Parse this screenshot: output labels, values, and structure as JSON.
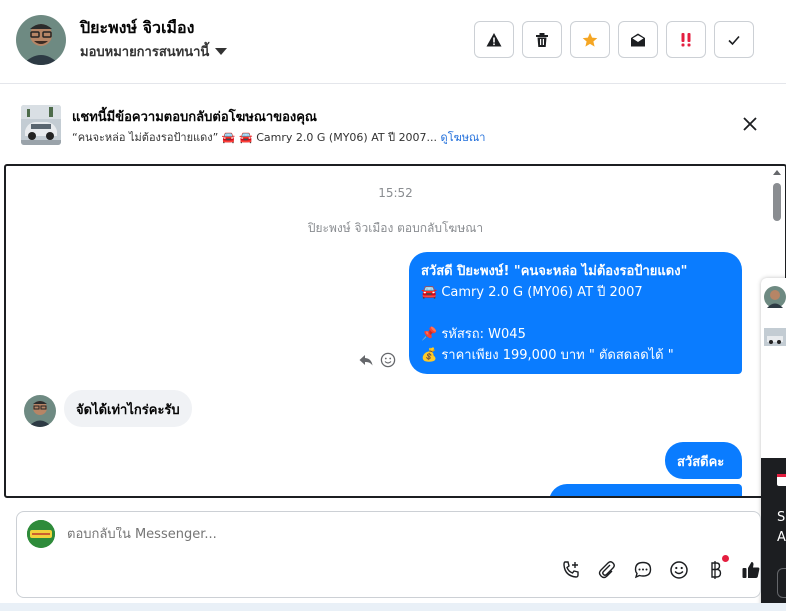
{
  "header": {
    "contact_name": "ปิยะพงษ์ จิวเมือง",
    "assign_label": "มอบหมายการสนทนานี้",
    "toolbar": [
      "spam",
      "delete",
      "star",
      "mark-unread",
      "important",
      "done"
    ]
  },
  "ad_banner": {
    "title": "แชทนี้มีข้อความตอบกลับต่อโฆษณาของคุณ",
    "subtitle": "“คนจะหล่อ ไม่ต้องรอป้ายแดง” 🚘 🚘 Camry 2.0 G (MY06) AT ปี 2007...",
    "link_label": "ดูโฆษณา"
  },
  "chat": {
    "timestamp": "15:52",
    "system_note": "ปิยะพงษ์ จิวเมือง ตอบกลับโฆษณา",
    "messages": [
      {
        "direction": "outgoing",
        "lines": [
          "สวัสดี ปิยะพงษ์! \"คนจะหล่อ ไม่ต้องรอป้ายแดง\"",
          "🚘 Camry 2.0 G (MY06) AT ปี 2007",
          "",
          "📌 รหัสรถ: W045",
          "💰 ราคาเพียง 199,000 บาท \" ตัดสดลดได้ \""
        ]
      },
      {
        "direction": "incoming",
        "text": "จัดได้เท่าไกร่คะรับ"
      },
      {
        "direction": "outgoing",
        "text": "สวัสดีคะ"
      }
    ]
  },
  "side_panel": {
    "letter1": "S",
    "letter2": "A"
  },
  "composer": {
    "placeholder": "ตอบกลับใน Messenger..."
  },
  "colors": {
    "accent": "#0a7cff",
    "incoming_bubble": "#f0f2f5",
    "star": "#f5a623",
    "important": "#e41e3f"
  }
}
